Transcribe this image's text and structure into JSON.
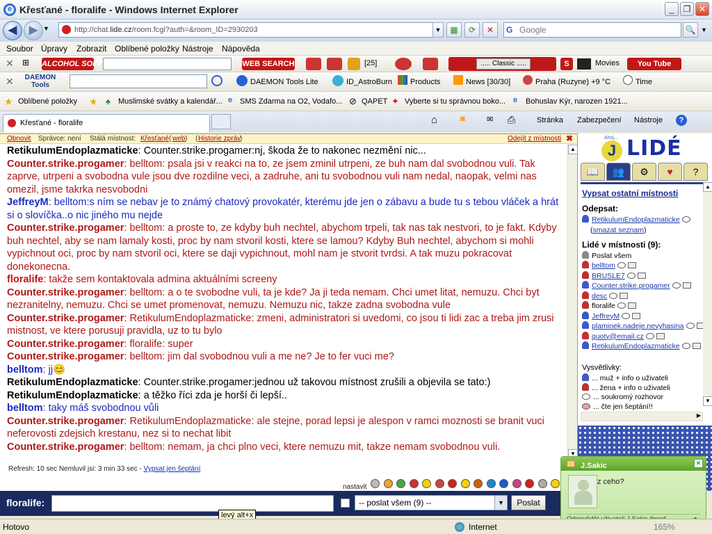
{
  "window": {
    "title": "Křesťané - floralife - Windows Internet Explorer"
  },
  "nav": {
    "url_prefix": "http://chat.",
    "url_domain": "lide.cz",
    "url_rest": "/room.fcgi?auth=&room_ID=2930203",
    "search_placeholder": "Google"
  },
  "menu": [
    "Soubor",
    "Úpravy",
    "Zobrazit",
    "Oblíbené položky",
    "Nástroje",
    "Nápověda"
  ],
  "toolbar1": {
    "alcohol": "ALCOHOL SOFT",
    "websearch": "WEB SEARCH",
    "count": "[25]",
    "classic": "..... Classic .....",
    "movies": "Movies",
    "youtube": "You Tube"
  },
  "toolbar2": {
    "daemon_logo": "DAEMON Tools",
    "daemon_lite": "DAEMON Tools Lite",
    "astroburn": "ID_AstroBurn",
    "products": "Products",
    "news": "News [30/30]",
    "weather": "Praha (Ruzyne) +9 °C",
    "time": "Time"
  },
  "favorites": {
    "label": "Oblíbené položky",
    "items": [
      "Muslimské svátky a kalendář...",
      "SMS Zdarma na O2, Vodafo...",
      "QAPET",
      "Vyberte si tu správnou boko...",
      "Bohuslav Kýr, narozen 1921..."
    ]
  },
  "tab": {
    "title": "Křesťané - floralife"
  },
  "commands": {
    "stranka": "Stránka",
    "zabezpeceni": "Zabezpečení",
    "nastroje": "Nástroje"
  },
  "infobar": {
    "obnovit": "Obnovit",
    "spravce": "Správce: není",
    "stala": "Stálá místnost:",
    "room": "Křesťané",
    "web": "web",
    "historie": "Historie zpráv",
    "odejit": "Odejít z místnosti"
  },
  "messages": [
    {
      "user": "RetikulumEndoplazmaticke",
      "style": "blk",
      "text": ": Counter.strike.progamer:nj, škoda že to nakonec nezmění nic..."
    },
    {
      "user": "Counter.strike.progamer",
      "style": "red",
      "text": ": belltom: psala jsi v reakci na to, ze jsem zminil utrpeni, ze buh nam dal svobodnou vuli. Tak zaprve, utrpeni a svobodna vule jsou dve rozdilne veci, a zadruhe, ani tu svobodnou vuli nam nedal, naopak, velmi nas omezil, jsme takrka nesvobodni"
    },
    {
      "user": "JeffreyM",
      "style": "blu",
      "text": ": belltom:s ním se nebav je to známý chatový provokatér, kterému jde jen o zábavu a bude tu s tebou vláček a hrát si o slovíčka..o nic jiného mu nejde"
    },
    {
      "user": "Counter.strike.progamer",
      "style": "red",
      "text": ": belltom: a proste to, ze kdyby buh nechtel, abychom trpeli, tak nas tak nestvori, to je fakt. Kdyby buh nechtel, aby se nam lamaly kosti, proc by nam stvoril kosti, ktere se lamou? Kdyby Buh nechtel, abychom si mohli vypichnout oci, proc by nam stvoril oci, ktere se daji vypichnout, mohl nam je stvorit tvrdsi. A tak muzu pokracovat donekonecna."
    },
    {
      "user": "floralife",
      "style": "flo",
      "text": ": takže sem kontaktovala admina aktuálními screeny"
    },
    {
      "user": "Counter.strike.progamer",
      "style": "red",
      "text": ": belltom: a o te svobodne vuli, ta je kde? Ja ji teda nemam. Chci umet litat, nemuzu. Chci byt nezranitelny, nemuzu. Chci se umet promenovat, nemuzu. Nemuzu nic, takze zadna svobodna vule"
    },
    {
      "user": "Counter.strike.progamer",
      "style": "red",
      "text": ": RetikulumEndoplazmaticke: zmeni, administratori si uvedomi, co jsou ti lidi zac a treba jim zrusi mistnost, ve ktere porusuji pravidla, uz to tu bylo"
    },
    {
      "user": "Counter.strike.progamer",
      "style": "red",
      "text": ": floralife: super"
    },
    {
      "user": "Counter.strike.progamer",
      "style": "red",
      "text": ": belltom: jim dal svobodnou vuli a me ne? Je to fer vuci me?"
    },
    {
      "user": "belltom",
      "style": "blu",
      "text": ": jj😊"
    },
    {
      "user": "RetikulumEndoplazmaticke",
      "style": "blk",
      "text": ": Counter.strike.progamer:jednou už takovou místnost zrušili a objevila se tato:)"
    },
    {
      "user": "RetikulumEndoplazmaticke",
      "style": "blk",
      "text": ": a těžko říci zda je horší či lepší.."
    },
    {
      "user": "belltom",
      "style": "blu",
      "text": ": taky máš svobodnou vůli"
    },
    {
      "user": "Counter.strike.progamer",
      "style": "red",
      "text": ": RetikulumEndoplazmaticke: ale stejne, porad lepsi je alespon v ramci moznosti se branit vuci neferovosti zdejsich krestanu, nez si to nechat libit"
    },
    {
      "user": "Counter.strike.progamer",
      "style": "red",
      "text": ": belltom: nemam, ja chci plno veci, ktere nemuzu mit, takze nemam svobodnou vuli."
    }
  ],
  "refresh": {
    "text": "Refresh: 10 sec   Nemluvil jsi: 3 min 33 sec - ",
    "link": "Vypsat jen šeptání"
  },
  "nastavit": "nastavit",
  "input": {
    "label": "floralife:",
    "select": "-- poslat všem (9) --",
    "send": "Poslat"
  },
  "tooltip": "levý alt+x",
  "side": {
    "logo": "LIDÉ",
    "logo_small": "Ahoj...",
    "logo_j": "J",
    "vypsat": "Vypsat ostatní místnosti",
    "odepsat": "Odepsat:",
    "odepsat_user": "RetikulumEndoplazmaticke",
    "smazat": "smazat seznam",
    "v_mistnosti": "Lidé v místnosti (9):",
    "poslat_vsem": "Poslat všem",
    "people": [
      {
        "name": "belltom",
        "g": "f"
      },
      {
        "name": "BRUSLE7",
        "g": "f"
      },
      {
        "name": "Counter.strike.progamer",
        "g": "m"
      },
      {
        "name": "desc",
        "g": "f"
      },
      {
        "name": "floralife",
        "g": "f"
      },
      {
        "name": "JeffreyM",
        "g": "m"
      },
      {
        "name": "plaminek.nadeje.nevyhasina",
        "g": "m"
      },
      {
        "name": "quoty@email.cz",
        "g": "f"
      },
      {
        "name": "RetikulumEndoplazmaticke",
        "g": "m"
      }
    ],
    "vysvetlivky": "Vysvětlivky:",
    "legend": [
      "... muž + info o uživateli",
      "... žena + info o uživateli",
      "... soukromý rozhovor",
      "... čte jen šeptání!!"
    ]
  },
  "popup": {
    "title": "J.Sakic",
    "message": "z ceho?",
    "reply": "Odpovědět uživateli J.Sakic ihned"
  },
  "status": {
    "left": "Hotovo",
    "zone": "Internet",
    "zoom": "165%"
  }
}
